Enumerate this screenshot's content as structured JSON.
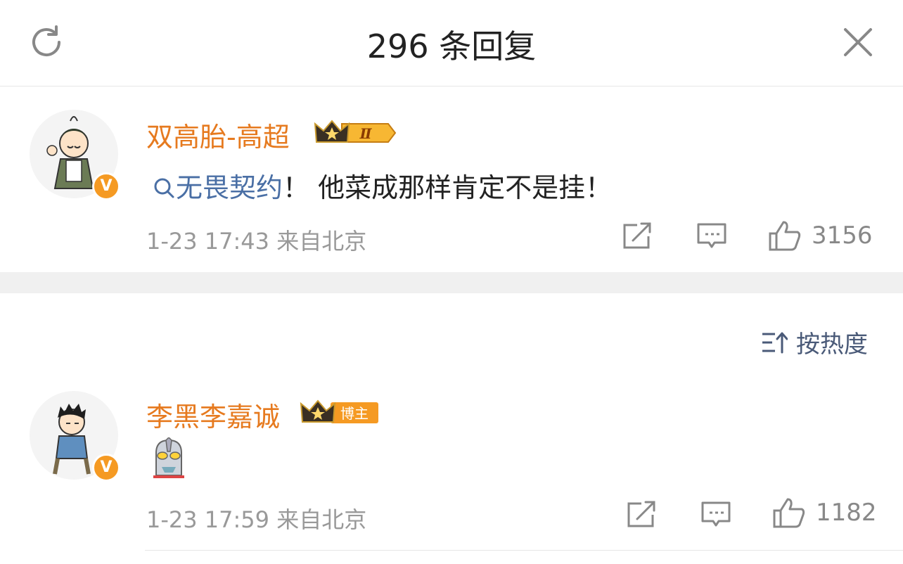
{
  "header": {
    "title": "296 条回复",
    "refresh_icon": "refresh-icon",
    "close_icon": "close-icon"
  },
  "main_comment": {
    "username": "双高胎-高超",
    "badge_level": "Ⅱ",
    "topic": "无畏契约",
    "text": "！ 他菜成那样肯定不是挂！",
    "time": "1-23 17:43",
    "location": "来自北京",
    "likes": "3156",
    "verified": "V"
  },
  "sort": {
    "label": "按热度"
  },
  "reply": {
    "username": "李黑李嘉诚",
    "badge_label": "博主",
    "time": "1-23 17:59",
    "location": "来自北京",
    "likes": "1182",
    "verified": "V",
    "emoji": "ultraman-emoji"
  },
  "colors": {
    "username": "#e67a1f",
    "topic": "#4a6fa5",
    "badge": "#f59a23",
    "meta": "#999999"
  }
}
